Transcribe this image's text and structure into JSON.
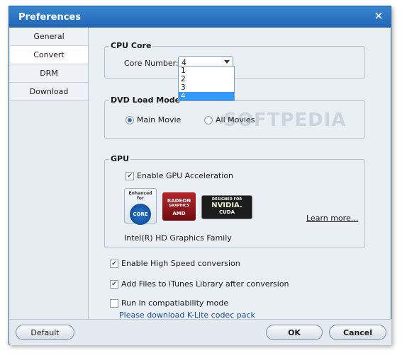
{
  "window": {
    "title": "Preferences"
  },
  "sidebar": {
    "items": [
      {
        "label": "General"
      },
      {
        "label": "Convert"
      },
      {
        "label": "DRM"
      },
      {
        "label": "Download"
      }
    ],
    "active_index": 1
  },
  "cpu": {
    "legend": "CPU Core",
    "label": "Core Number:",
    "selected": "4",
    "options": [
      "1",
      "2",
      "3",
      "4"
    ]
  },
  "dvd": {
    "legend": "DVD Load Mode",
    "main_movie": "Main Movie",
    "all_movies": "All Movies",
    "selected": "Main Movie"
  },
  "gpu": {
    "legend": "GPU",
    "enable_label": "Enable GPU Acceleration",
    "enable_checked": true,
    "intel_top": "Enhanced for",
    "intel_core": "CORE",
    "amd_brand": "RADEON",
    "amd_sub": "GRAPHICS",
    "amd_tag": "AMD",
    "nvidia_top": "DESIGNED FOR",
    "nvidia_brand": "NVIDIA.",
    "nvidia_sub": "CUDA",
    "learn_more": "Learn more...",
    "graphics_family": "Intel(R) HD Graphics Family"
  },
  "options": {
    "high_speed": {
      "label": "Enable High Speed conversion",
      "checked": true
    },
    "itunes": {
      "label": "Add Files to iTunes Library after conversion",
      "checked": true
    },
    "compat": {
      "label": "Run in compatiability mode",
      "checked": false
    },
    "klite_link": "Please download K-Lite codec pack"
  },
  "buttons": {
    "default": "Default",
    "ok": "OK",
    "cancel": "Cancel"
  },
  "watermark": "SOFTPEDIA",
  "colors": {
    "titlebar": "#1f66b6",
    "link": "#1a4fa0",
    "selection": "#3399ff"
  }
}
